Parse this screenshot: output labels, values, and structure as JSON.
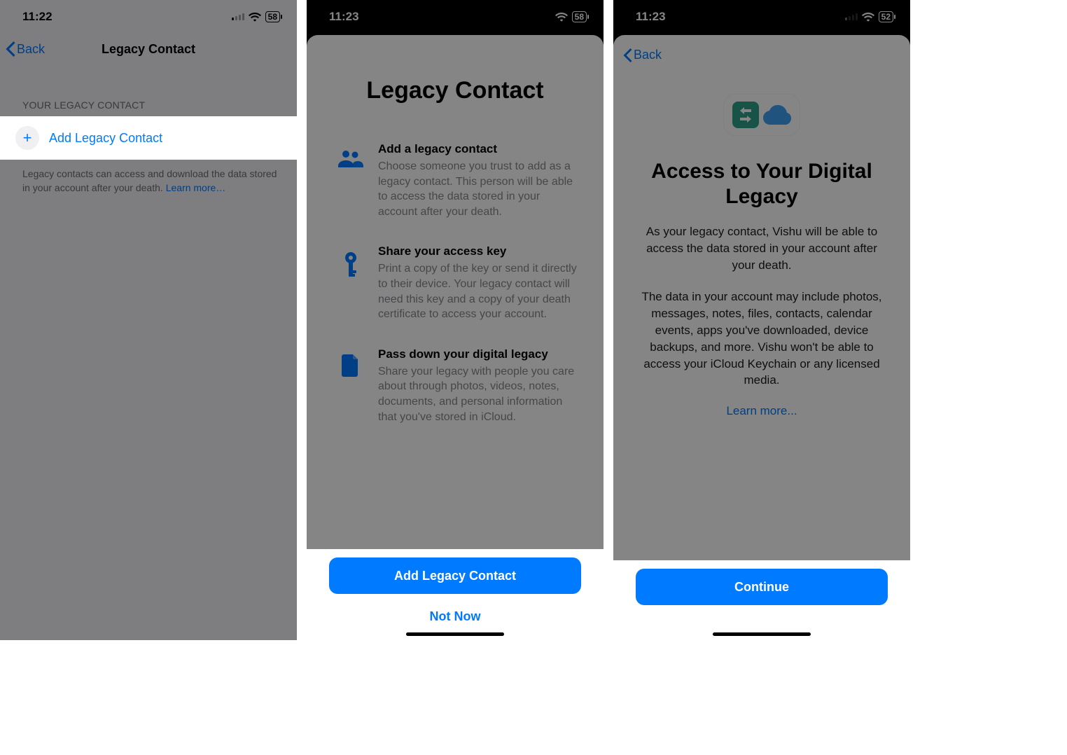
{
  "screen1": {
    "status_time": "11:22",
    "status_battery": "58",
    "back_label": "Back",
    "title": "Legacy Contact",
    "section_header": "YOUR LEGACY CONTACT",
    "add_row_label": "Add Legacy Contact",
    "footer_text": "Legacy contacts can access and download the data stored in your account after your death. ",
    "learn_more": "Learn more…"
  },
  "screen2": {
    "status_time": "11:23",
    "status_battery": "58",
    "title": "Legacy Contact",
    "rows": [
      {
        "heading": "Add a legacy contact",
        "body": "Choose someone you trust to add as a legacy contact. This person will be able to access the data stored in your account after your death."
      },
      {
        "heading": "Share your access key",
        "body": "Print a copy of the key or send it directly to their device. Your legacy contact will need this key and a copy of your death certificate to access your account."
      },
      {
        "heading": "Pass down your digital legacy",
        "body": "Share your legacy with people you care about through photos, videos, notes, documents, and personal information that you've stored in iCloud."
      }
    ],
    "primary_button": "Add Legacy Contact",
    "secondary_button": "Not Now"
  },
  "screen3": {
    "status_time": "11:23",
    "status_battery": "52",
    "back_label": "Back",
    "title": "Access to Your Digital Legacy",
    "body1": "As your legacy contact, Vishu will be able to access the data stored in your account after your death.",
    "body2": "The data in your account may include photos, messages, notes, files, contacts, calendar events, apps you've downloaded, device backups, and more. Vishu won't be able to access your iCloud Keychain or any licensed media.",
    "learn_more": "Learn more...",
    "primary_button": "Continue"
  }
}
